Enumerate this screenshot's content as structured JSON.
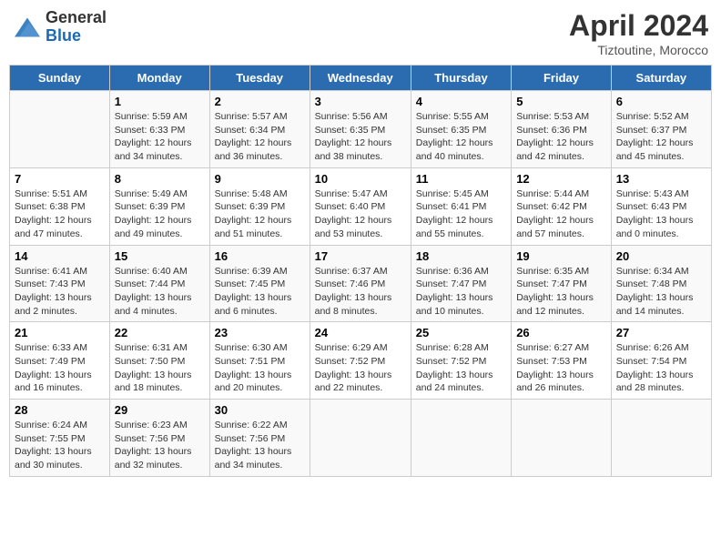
{
  "header": {
    "logo_line1": "General",
    "logo_line2": "Blue",
    "month": "April 2024",
    "location": "Tiztoutine, Morocco"
  },
  "days_of_week": [
    "Sunday",
    "Monday",
    "Tuesday",
    "Wednesday",
    "Thursday",
    "Friday",
    "Saturday"
  ],
  "weeks": [
    [
      {
        "num": "",
        "detail": ""
      },
      {
        "num": "1",
        "detail": "Sunrise: 5:59 AM\nSunset: 6:33 PM\nDaylight: 12 hours\nand 34 minutes."
      },
      {
        "num": "2",
        "detail": "Sunrise: 5:57 AM\nSunset: 6:34 PM\nDaylight: 12 hours\nand 36 minutes."
      },
      {
        "num": "3",
        "detail": "Sunrise: 5:56 AM\nSunset: 6:35 PM\nDaylight: 12 hours\nand 38 minutes."
      },
      {
        "num": "4",
        "detail": "Sunrise: 5:55 AM\nSunset: 6:35 PM\nDaylight: 12 hours\nand 40 minutes."
      },
      {
        "num": "5",
        "detail": "Sunrise: 5:53 AM\nSunset: 6:36 PM\nDaylight: 12 hours\nand 42 minutes."
      },
      {
        "num": "6",
        "detail": "Sunrise: 5:52 AM\nSunset: 6:37 PM\nDaylight: 12 hours\nand 45 minutes."
      }
    ],
    [
      {
        "num": "7",
        "detail": "Sunrise: 5:51 AM\nSunset: 6:38 PM\nDaylight: 12 hours\nand 47 minutes."
      },
      {
        "num": "8",
        "detail": "Sunrise: 5:49 AM\nSunset: 6:39 PM\nDaylight: 12 hours\nand 49 minutes."
      },
      {
        "num": "9",
        "detail": "Sunrise: 5:48 AM\nSunset: 6:39 PM\nDaylight: 12 hours\nand 51 minutes."
      },
      {
        "num": "10",
        "detail": "Sunrise: 5:47 AM\nSunset: 6:40 PM\nDaylight: 12 hours\nand 53 minutes."
      },
      {
        "num": "11",
        "detail": "Sunrise: 5:45 AM\nSunset: 6:41 PM\nDaylight: 12 hours\nand 55 minutes."
      },
      {
        "num": "12",
        "detail": "Sunrise: 5:44 AM\nSunset: 6:42 PM\nDaylight: 12 hours\nand 57 minutes."
      },
      {
        "num": "13",
        "detail": "Sunrise: 5:43 AM\nSunset: 6:43 PM\nDaylight: 13 hours\nand 0 minutes."
      }
    ],
    [
      {
        "num": "14",
        "detail": "Sunrise: 6:41 AM\nSunset: 7:43 PM\nDaylight: 13 hours\nand 2 minutes."
      },
      {
        "num": "15",
        "detail": "Sunrise: 6:40 AM\nSunset: 7:44 PM\nDaylight: 13 hours\nand 4 minutes."
      },
      {
        "num": "16",
        "detail": "Sunrise: 6:39 AM\nSunset: 7:45 PM\nDaylight: 13 hours\nand 6 minutes."
      },
      {
        "num": "17",
        "detail": "Sunrise: 6:37 AM\nSunset: 7:46 PM\nDaylight: 13 hours\nand 8 minutes."
      },
      {
        "num": "18",
        "detail": "Sunrise: 6:36 AM\nSunset: 7:47 PM\nDaylight: 13 hours\nand 10 minutes."
      },
      {
        "num": "19",
        "detail": "Sunrise: 6:35 AM\nSunset: 7:47 PM\nDaylight: 13 hours\nand 12 minutes."
      },
      {
        "num": "20",
        "detail": "Sunrise: 6:34 AM\nSunset: 7:48 PM\nDaylight: 13 hours\nand 14 minutes."
      }
    ],
    [
      {
        "num": "21",
        "detail": "Sunrise: 6:33 AM\nSunset: 7:49 PM\nDaylight: 13 hours\nand 16 minutes."
      },
      {
        "num": "22",
        "detail": "Sunrise: 6:31 AM\nSunset: 7:50 PM\nDaylight: 13 hours\nand 18 minutes."
      },
      {
        "num": "23",
        "detail": "Sunrise: 6:30 AM\nSunset: 7:51 PM\nDaylight: 13 hours\nand 20 minutes."
      },
      {
        "num": "24",
        "detail": "Sunrise: 6:29 AM\nSunset: 7:52 PM\nDaylight: 13 hours\nand 22 minutes."
      },
      {
        "num": "25",
        "detail": "Sunrise: 6:28 AM\nSunset: 7:52 PM\nDaylight: 13 hours\nand 24 minutes."
      },
      {
        "num": "26",
        "detail": "Sunrise: 6:27 AM\nSunset: 7:53 PM\nDaylight: 13 hours\nand 26 minutes."
      },
      {
        "num": "27",
        "detail": "Sunrise: 6:26 AM\nSunset: 7:54 PM\nDaylight: 13 hours\nand 28 minutes."
      }
    ],
    [
      {
        "num": "28",
        "detail": "Sunrise: 6:24 AM\nSunset: 7:55 PM\nDaylight: 13 hours\nand 30 minutes."
      },
      {
        "num": "29",
        "detail": "Sunrise: 6:23 AM\nSunset: 7:56 PM\nDaylight: 13 hours\nand 32 minutes."
      },
      {
        "num": "30",
        "detail": "Sunrise: 6:22 AM\nSunset: 7:56 PM\nDaylight: 13 hours\nand 34 minutes."
      },
      {
        "num": "",
        "detail": ""
      },
      {
        "num": "",
        "detail": ""
      },
      {
        "num": "",
        "detail": ""
      },
      {
        "num": "",
        "detail": ""
      }
    ]
  ]
}
